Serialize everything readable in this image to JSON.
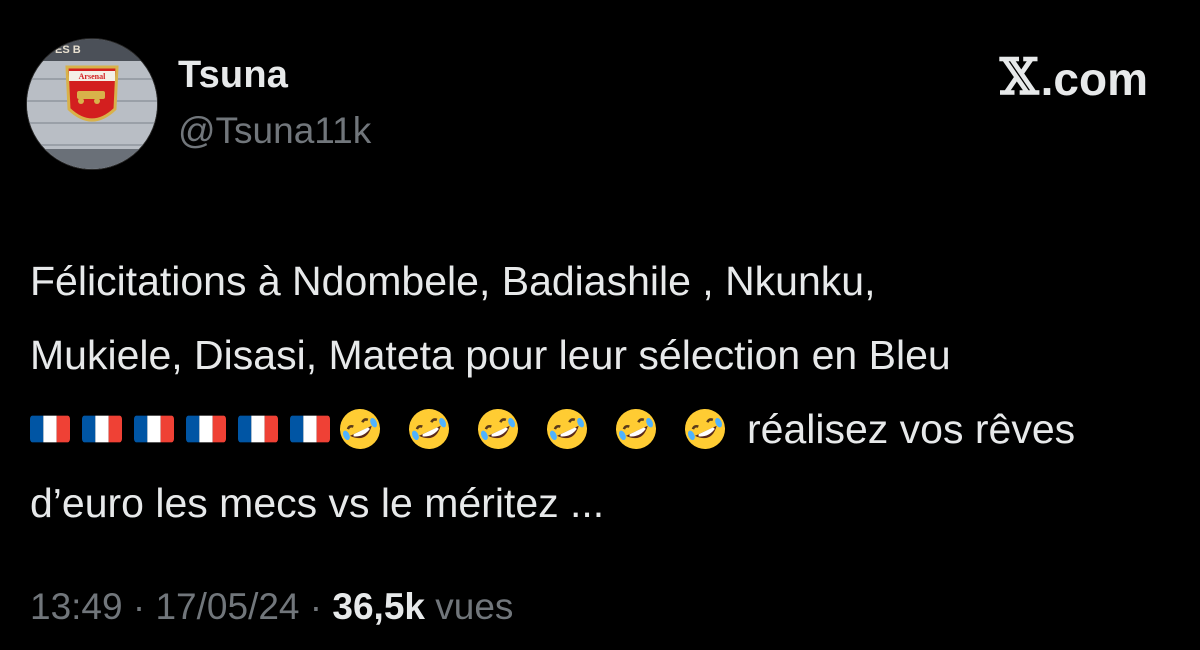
{
  "author": {
    "display_name": "Tsuna",
    "handle": "@Tsuna11k",
    "avatar_badge_text": "Arsenal",
    "avatar_sign_text": "ES B"
  },
  "brand": {
    "logo_text": ".com",
    "logo_icon": "x-logo-icon"
  },
  "tweet": {
    "line1": "Félicitations à Ndombele, Badiashile , Nkunku,",
    "line2": "Mukiele, Disasi, Mateta pour leur sélection en Bleu",
    "emoji_flags": [
      "france-flag-icon",
      "france-flag-icon",
      "france-flag-icon",
      "france-flag-icon",
      "france-flag-icon",
      "france-flag-icon"
    ],
    "emoji_laughs": [
      "rofl-emoji-icon",
      "rofl-emoji-icon",
      "rofl-emoji-icon",
      "rofl-emoji-icon",
      "rofl-emoji-icon",
      "rofl-emoji-icon"
    ],
    "line3_tail": "réalisez vos rêves",
    "line4": "d’euro les mecs vs le méritez ..."
  },
  "meta": {
    "time": "13:49",
    "separator1": " · ",
    "date": "17/05/24",
    "separator2": " · ",
    "views_count": "36,5k",
    "views_label": " vues"
  },
  "colors": {
    "background": "#000000",
    "primary_text": "#e7e9ea",
    "secondary_text": "#71767b",
    "flag_blue": "#0055a4",
    "flag_red": "#ef4135",
    "emoji_yellow": "#ffcc33"
  }
}
